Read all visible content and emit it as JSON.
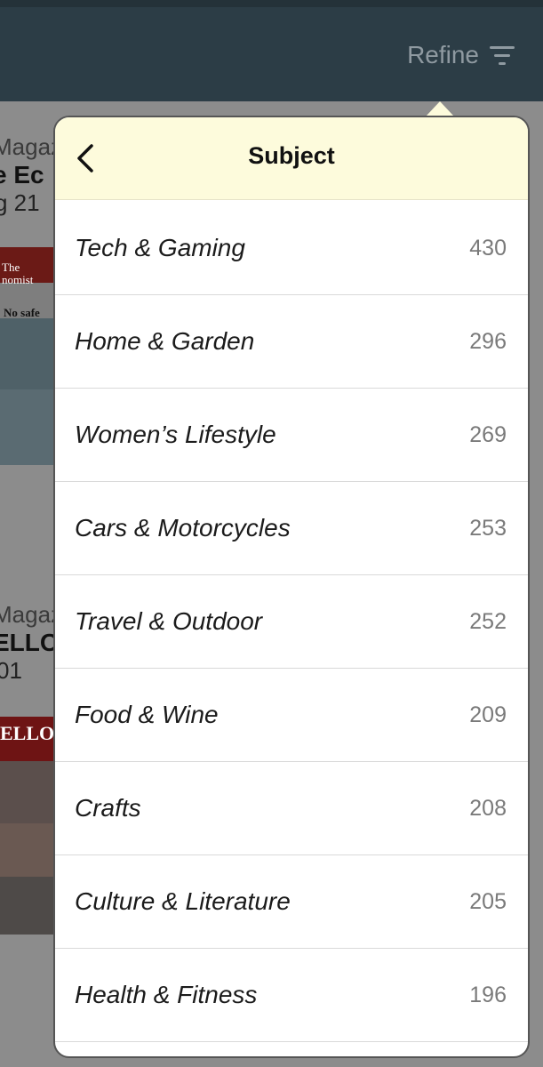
{
  "header": {
    "refine_label": "Refine",
    "refine_icon": "filter-lines-icon"
  },
  "background": {
    "items": [
      {
        "category": "Magazi",
        "title": "e Ec",
        "date": "g 21",
        "cover_text": "The\nnomist",
        "cover_headline": "No safe"
      },
      {
        "category": "Magazi",
        "title": "ELLO",
        "date": "01",
        "cover_text": "ELLO",
        "cover_headline": ""
      }
    ]
  },
  "popover": {
    "title": "Subject",
    "back_icon": "chevron-left-icon",
    "header_bg": "#fdfbdc",
    "subjects": [
      {
        "label": "Tech & Gaming",
        "count": "430"
      },
      {
        "label": "Home & Garden",
        "count": "296"
      },
      {
        "label": "Women’s Lifestyle",
        "count": "269"
      },
      {
        "label": "Cars & Motorcycles",
        "count": "253"
      },
      {
        "label": "Travel & Outdoor",
        "count": "252"
      },
      {
        "label": "Food & Wine",
        "count": "209"
      },
      {
        "label": "Crafts",
        "count": "208"
      },
      {
        "label": "Culture & Literature",
        "count": "205"
      },
      {
        "label": "Health & Fitness",
        "count": "196"
      }
    ]
  },
  "colors": {
    "topbar": "#2c3d46",
    "refine_text": "#8f9aa1"
  }
}
